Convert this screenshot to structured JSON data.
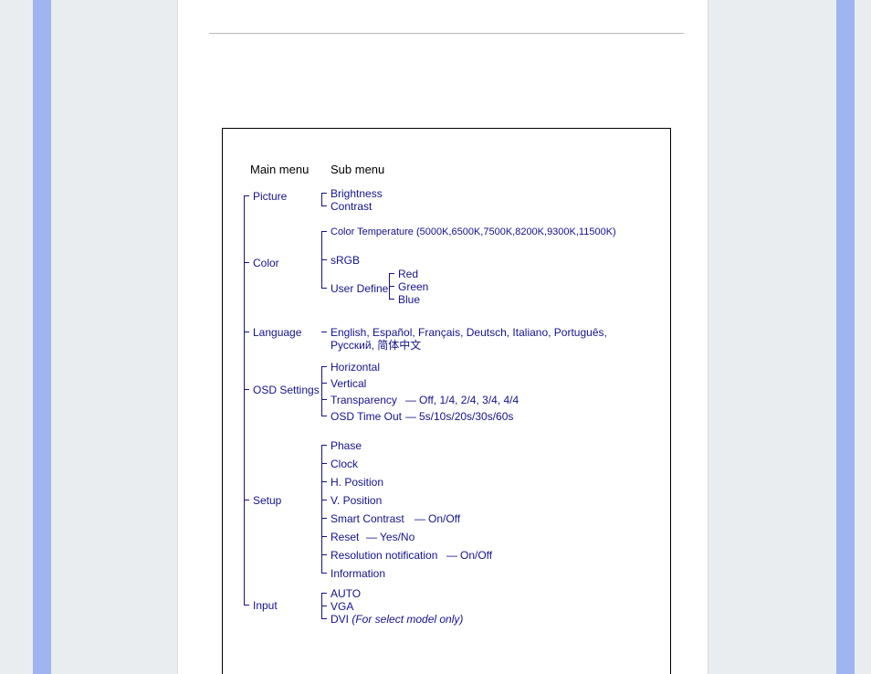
{
  "headers": {
    "main": "Main menu",
    "sub": "Sub menu"
  },
  "menu": {
    "picture": {
      "label": "Picture",
      "items": [
        "Brightness",
        "Contrast"
      ]
    },
    "color": {
      "label": "Color",
      "colortemp": "Color Temperature (5000K,6500K,7500K,8200K,9300K,11500K)",
      "srgb": "sRGB",
      "userdefine": "User Define",
      "rgb": [
        "Red",
        "Green",
        "Blue"
      ]
    },
    "language": {
      "label": "Language",
      "line1": "English, Español, Français, Deutsch, Italiano, Português,",
      "line2": "Русский, 简体中文"
    },
    "osd": {
      "label": "OSD Settings",
      "items": [
        "Horizontal",
        "Vertical",
        "Transparency",
        "OSD Time Out"
      ],
      "transp_vals": "Off, 1/4, 2/4, 3/4, 4/4",
      "timeout_vals": "5s/10s/20s/30s/60s"
    },
    "setup": {
      "label": "Setup",
      "items": [
        "Phase",
        "Clock",
        "H. Position",
        "V. Position",
        "Smart Contrast",
        "Reset",
        "Resolution notification",
        "Information"
      ],
      "smart_vals": "On/Off",
      "reset_vals": "Yes/No",
      "res_vals": "On/Off"
    },
    "input": {
      "label": "Input",
      "items": [
        "AUTO",
        "VGA",
        "DVI "
      ],
      "dvi_note": "(For select model only)"
    }
  },
  "sep": {
    "dash": "—",
    "dash2": "—"
  }
}
